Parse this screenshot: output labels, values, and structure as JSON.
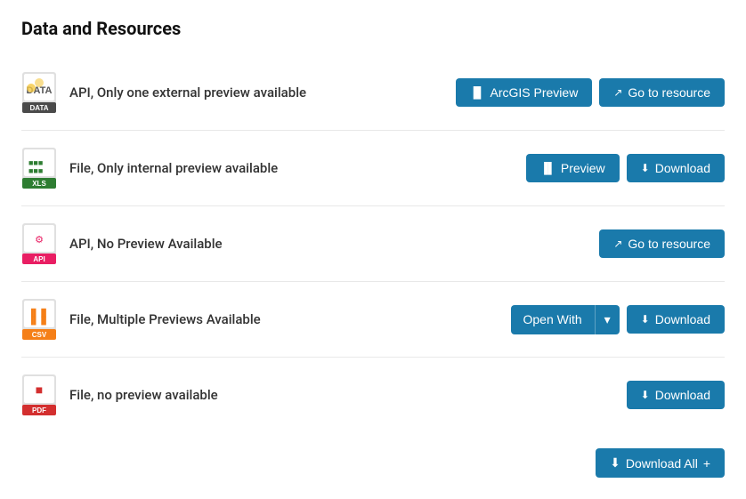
{
  "page": {
    "title": "Data and Resources"
  },
  "resources": [
    {
      "id": "resource-1",
      "icon_type": "data",
      "label": "API, Only one external preview available",
      "actions": [
        {
          "type": "preview",
          "label": "ArcGIS Preview",
          "icon": "chart"
        },
        {
          "type": "goto",
          "label": "Go to resource",
          "icon": "external"
        }
      ]
    },
    {
      "id": "resource-2",
      "icon_type": "xls",
      "label": "File, Only internal preview available",
      "actions": [
        {
          "type": "preview",
          "label": "Preview",
          "icon": "chart"
        },
        {
          "type": "download",
          "label": "Download",
          "icon": "download"
        }
      ]
    },
    {
      "id": "resource-3",
      "icon_type": "api",
      "label": "API, No Preview Available",
      "actions": [
        {
          "type": "goto",
          "label": "Go to resource",
          "icon": "external"
        }
      ]
    },
    {
      "id": "resource-4",
      "icon_type": "csv",
      "label": "File, Multiple Previews Available",
      "actions": [
        {
          "type": "split",
          "label": "Open With",
          "icon": "none"
        },
        {
          "type": "download",
          "label": "Download",
          "icon": "download"
        }
      ]
    },
    {
      "id": "resource-5",
      "icon_type": "pdf",
      "label": "File, no preview available",
      "actions": [
        {
          "type": "download",
          "label": "Download",
          "icon": "download"
        }
      ]
    }
  ],
  "download_all": {
    "label": "Download All"
  },
  "icons": {
    "chart": "▐▐",
    "download": "⬇",
    "external": "↗",
    "caret_down": "▾"
  }
}
